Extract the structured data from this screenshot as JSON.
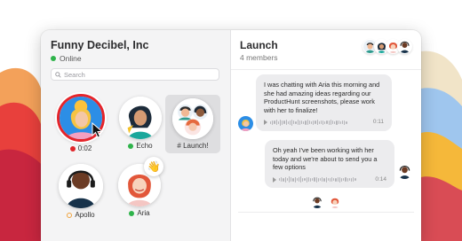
{
  "space": {
    "title": "Funny Decibel, Inc",
    "status": "Online"
  },
  "search": {
    "placeholder": "Search"
  },
  "tiles": {
    "user1": {
      "label": "0:02",
      "status_color": "#e0252a"
    },
    "echo": {
      "label": "Echo",
      "status_color": "#2fb34b"
    },
    "launch": {
      "label": "# Launch!"
    },
    "apollo": {
      "label": "Apollo",
      "status_color": "#f0a23a"
    },
    "aria": {
      "label": "Aria",
      "status_color": "#2fb34b"
    }
  },
  "wave_emoji": "👋",
  "chat": {
    "title": "Launch",
    "members": "4 members",
    "messages": [
      {
        "text": "I was chatting with Aria this morning and she had amazing ideas regarding our ProductHunt screenshots, please work with her to finalize!",
        "duration": "0:11"
      },
      {
        "text": "Oh yeah I've been working with her today and we're about to send you a few options",
        "duration": "0:14"
      }
    ]
  },
  "colors": {
    "accent_red": "#e5242a",
    "online_green": "#2fb34b",
    "away_orange": "#f0a23a"
  }
}
